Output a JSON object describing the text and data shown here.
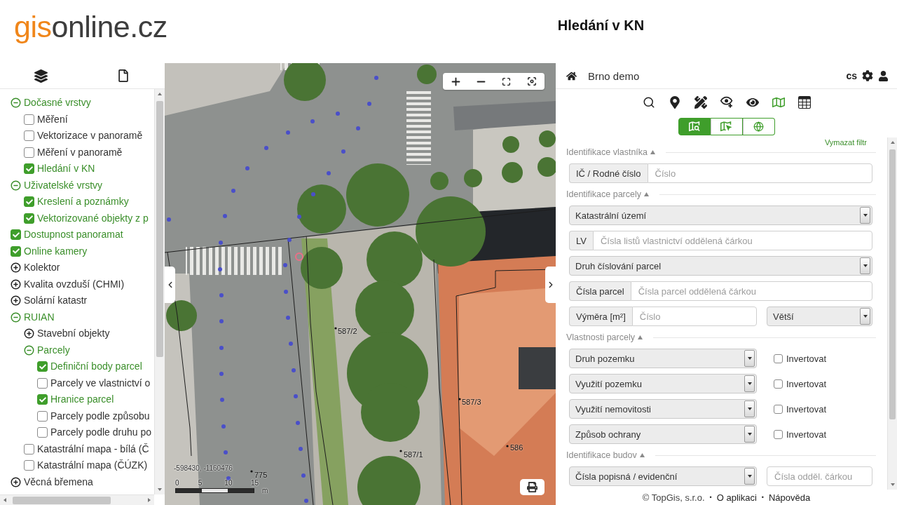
{
  "header": {
    "logo": {
      "accent": "gis",
      "rest": "online.cz"
    },
    "title": "Hledání v KN"
  },
  "layers": [
    {
      "kind": "group",
      "label": "Dočasné vrstvy",
      "expanded": true,
      "children": [
        {
          "kind": "layer",
          "label": "Měření",
          "checked": false
        },
        {
          "kind": "layer",
          "label": "Vektorizace v panoramě",
          "checked": false
        },
        {
          "kind": "layer",
          "label": "Měření v panoramě",
          "checked": false
        },
        {
          "kind": "layer",
          "label": "Hledání v KN",
          "checked": true
        }
      ]
    },
    {
      "kind": "group",
      "label": "Uživatelské vrstvy",
      "expanded": true,
      "children": [
        {
          "kind": "layer",
          "label": "Kreslení a poznámky",
          "checked": true
        },
        {
          "kind": "layer",
          "label": "Vektorizované objekty z p",
          "checked": true
        }
      ]
    },
    {
      "kind": "layer",
      "label": "Dostupnost panoramat",
      "checked": true
    },
    {
      "kind": "layer",
      "label": "Online kamery",
      "checked": true
    },
    {
      "kind": "group",
      "label": "Kolektor",
      "expanded": false
    },
    {
      "kind": "group",
      "label": "Kvalita ovzduší (CHMI)",
      "expanded": false
    },
    {
      "kind": "group",
      "label": "Solární katastr",
      "expanded": false
    },
    {
      "kind": "group",
      "label": "RUIAN",
      "expanded": true,
      "children": [
        {
          "kind": "group",
          "label": "Stavební objekty",
          "expanded": false
        },
        {
          "kind": "group",
          "label": "Parcely",
          "expanded": true,
          "children": [
            {
              "kind": "layer",
              "label": "Definiční body parcel",
              "checked": true
            },
            {
              "kind": "layer",
              "label": "Parcely ve vlastnictví o",
              "checked": false
            },
            {
              "kind": "layer",
              "label": "Hranice parcel",
              "checked": true
            },
            {
              "kind": "layer",
              "label": "Parcely podle způsobu",
              "checked": false
            },
            {
              "kind": "layer",
              "label": "Parcely podle druhu po",
              "checked": false
            }
          ]
        },
        {
          "kind": "layer",
          "label": "Katastrální mapa - bílá (Č",
          "checked": false
        },
        {
          "kind": "layer",
          "label": "Katastrální mapa (ČÚZK)",
          "checked": false
        }
      ]
    },
    {
      "kind": "group",
      "label": "Věcná břemena",
      "expanded": false
    }
  ],
  "map": {
    "parcel_labels": [
      "587/2",
      "587/3",
      "586",
      "587/1",
      "775"
    ],
    "coordinates": "-598430, -1160476",
    "scale_ticks": [
      "0",
      "5",
      "10",
      "15"
    ],
    "scale_unit": "m"
  },
  "panel": {
    "project": "Brno demo",
    "language": "cs",
    "tools": [
      {
        "kind": "search",
        "selected": false
      },
      {
        "kind": "pin",
        "selected": false
      },
      {
        "kind": "measure",
        "selected": false
      },
      {
        "kind": "eye-plus",
        "selected": false
      },
      {
        "kind": "eye",
        "selected": false
      },
      {
        "kind": "map",
        "selected": true
      },
      {
        "kind": "table",
        "selected": false
      }
    ],
    "modes": [
      {
        "kind": "map-search",
        "selected": true
      },
      {
        "kind": "map-select",
        "selected": false
      },
      {
        "kind": "globe",
        "selected": false
      }
    ],
    "clear_filter": "Vymazat filtr",
    "sections": [
      {
        "title": "Identifikace vlastníka",
        "expanded": true,
        "rows": [
          {
            "kind": "input",
            "label": "IČ / Rodné číslo",
            "placeholder": "Číslo"
          }
        ]
      },
      {
        "title": "Identifikace parcely",
        "expanded": true,
        "rows": [
          {
            "kind": "select",
            "value": "Katastrální území"
          },
          {
            "kind": "input",
            "label": "LV",
            "placeholder": "Čísla listů vlastnictví oddělená čárkou"
          },
          {
            "kind": "select",
            "value": "Druh číslování parcel"
          },
          {
            "kind": "input",
            "label": "Čísla parcel",
            "placeholder": "Čísla parcel oddělená čárkou"
          },
          {
            "kind": "input-select",
            "label": "Výměra [m²]",
            "placeholder": "Číslo",
            "value": "Větší"
          }
        ]
      },
      {
        "title": "Vlastnosti parcely",
        "expanded": true,
        "rows": [
          {
            "kind": "select-check",
            "value": "Druh pozemku",
            "check_label": "Invertovat",
            "checked": false
          },
          {
            "kind": "select-check",
            "value": "Využití pozemku",
            "check_label": "Invertovat",
            "checked": false
          },
          {
            "kind": "select-check",
            "value": "Využití nemovitosti",
            "check_label": "Invertovat",
            "checked": false
          },
          {
            "kind": "select-check",
            "value": "Způsob ochrany",
            "check_label": "Invertovat",
            "checked": false
          }
        ]
      },
      {
        "title": "Identifikace budov",
        "expanded": true,
        "rows": [
          {
            "kind": "select-input",
            "value": "Čísla popisná / evidenční",
            "placeholder": "Čísla odděl. čárkou"
          }
        ]
      }
    ],
    "footer": [
      {
        "kind": "text",
        "text": "© TopGis, s.r.o."
      },
      {
        "kind": "separator",
        "text": "•"
      },
      {
        "kind": "link",
        "text": "O aplikaci"
      },
      {
        "kind": "separator",
        "text": "•"
      },
      {
        "kind": "link",
        "text": "Nápověda"
      }
    ]
  }
}
